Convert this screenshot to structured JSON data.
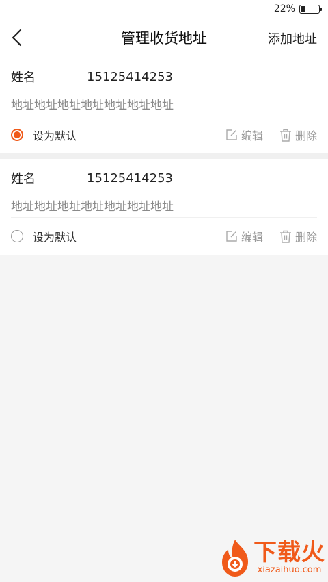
{
  "status_bar": {
    "battery_text": "22%",
    "battery_level": 0.22
  },
  "nav": {
    "title": "管理收货地址",
    "add_label": "添加地址"
  },
  "addresses": [
    {
      "name": "姓名",
      "phone": "15125414253",
      "address": "地址地址地址地址地址地址地址",
      "is_default": true,
      "default_label": "设为默认",
      "edit_label": "编辑",
      "delete_label": "删除"
    },
    {
      "name": "姓名",
      "phone": "15125414253",
      "address": "地址地址地址地址地址地址地址",
      "is_default": false,
      "default_label": "设为默认",
      "edit_label": "编辑",
      "delete_label": "删除"
    }
  ],
  "watermark": {
    "title": "下载火",
    "url": "xiazaihuo.com"
  },
  "colors": {
    "accent": "#f05a1a",
    "muted": "#999999",
    "background": "#f5f5f5"
  }
}
